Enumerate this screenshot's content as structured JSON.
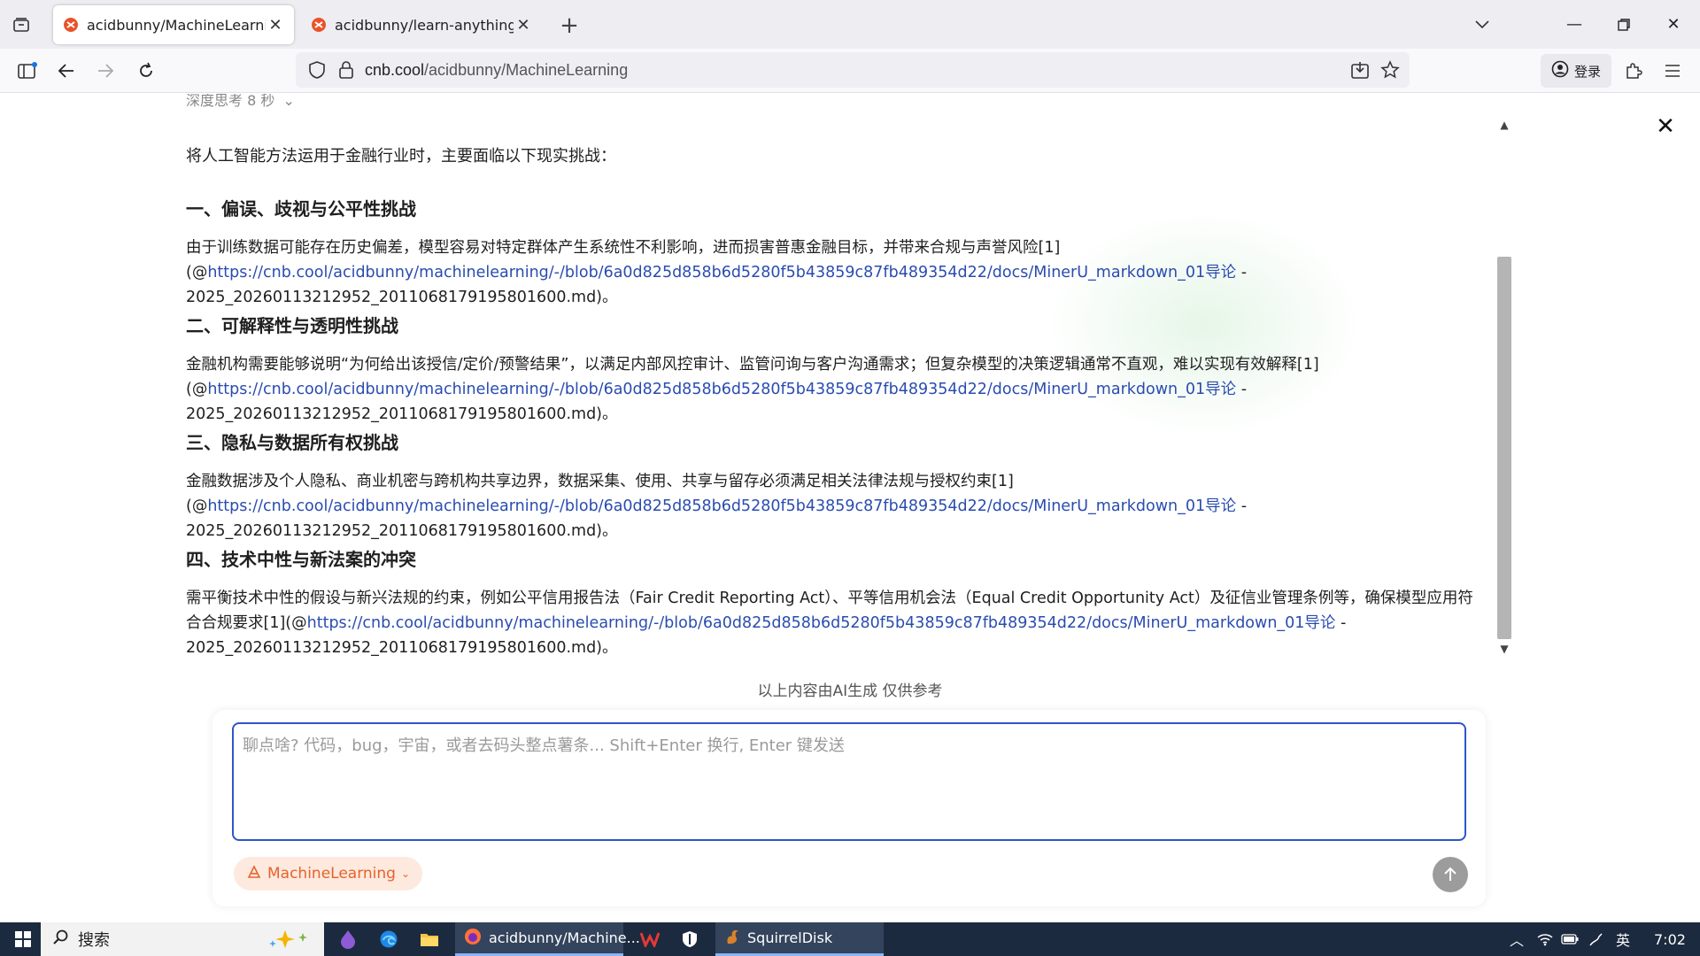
{
  "browser": {
    "tabs": [
      {
        "title": "acidbunny/MachineLearning",
        "active": true
      },
      {
        "title": "acidbunny/learn-anything · C",
        "active": false
      }
    ],
    "url_host": "cnb.cool",
    "url_path": "/acidbunny/MachineLearning",
    "login_label": "登录"
  },
  "article": {
    "thinking_label": "深度思考 8 秒",
    "intro": "将人工智能方法运用于金融行业时，主要面临以下现实挑战：",
    "sections": [
      {
        "heading": "一、偏误、歧视与公平性挑战",
        "text": "由于训练数据可能存在历史偏差，模型容易对特定群体产生系统性不利影响，进而损害普惠金融目标，并带来合规与声誉风险[1](@",
        "link": "https://cnb.cool/acidbunny/machinelearning/-/blob/6a0d825d858b6d5280f5b43859c87fb489354d22/docs/MinerU_markdown_01导论",
        "tail": " - 2025_20260113212952_2011068179195801600.md)。"
      },
      {
        "heading": "二、可解释性与透明性挑战",
        "text": "金融机构需要能够说明“为何给出该授信/定价/预警结果”，以满足内部风控审计、监管问询与客户沟通需求；但复杂模型的决策逻辑通常不直观，难以实现有效解释[1](@",
        "link": "https://cnb.cool/acidbunny/machinelearning/-/blob/6a0d825d858b6d5280f5b43859c87fb489354d22/docs/MinerU_markdown_01导论",
        "tail": " - 2025_20260113212952_2011068179195801600.md)。"
      },
      {
        "heading": "三、隐私与数据所有权挑战",
        "text": "金融数据涉及个人隐私、商业机密与跨机构共享边界，数据采集、使用、共享与留存必须满足相关法律法规与授权约束[1](@",
        "link": "https://cnb.cool/acidbunny/machinelearning/-/blob/6a0d825d858b6d5280f5b43859c87fb489354d22/docs/MinerU_markdown_01导论",
        "tail": " - 2025_20260113212952_2011068179195801600.md)。"
      },
      {
        "heading": "四、技术中性与新法案的冲突",
        "text": "需平衡技术中性的假设与新兴法规的约束，例如公平信用报告法（Fair Credit Reporting Act）、平等信用机会法（Equal Credit Opportunity Act）及征信业管理条例等，确保模型应用符合合规要求[1](@",
        "link": "https://cnb.cool/acidbunny/machinelearning/-/blob/6a0d825d858b6d5280f5b43859c87fb489354d22/docs/MinerU_markdown_01导论",
        "tail": " - 2025_20260113212952_2011068179195801600.md)。"
      }
    ],
    "disclaimer": "以上内容由AI生成 仅供参考"
  },
  "chat": {
    "placeholder": "聊点啥? 代码，bug，宇宙，或者去码头整点薯条... Shift+Enter 换行, Enter 键发送",
    "repo_label": "MachineLearning"
  },
  "taskbar": {
    "search_label": "搜索",
    "apps": [
      {
        "label": "acidbunny/Machine..."
      },
      {
        "label": "SquirrelDisk"
      }
    ],
    "ime": "英",
    "time": "7:02"
  }
}
